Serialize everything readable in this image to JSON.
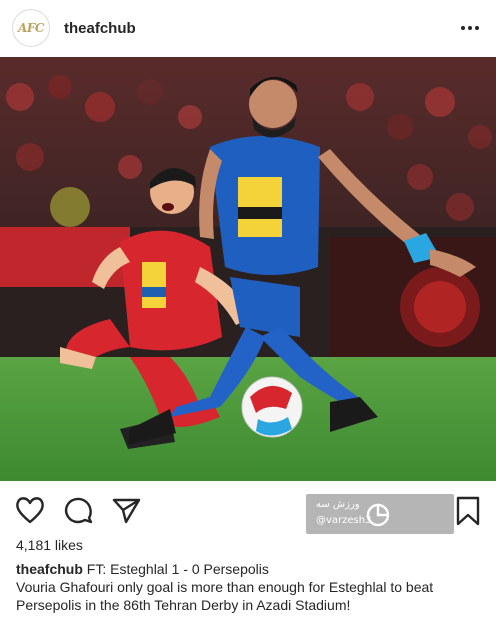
{
  "header": {
    "avatar_text": "AFC",
    "username": "theafchub",
    "more_icon": "more-horizontal-icon"
  },
  "post": {
    "image_alt": "Football players from Persepolis and Esteghlal contesting the ball",
    "watermark": {
      "arabic": "ورزش سه",
      "handle": "@varzesh3"
    }
  },
  "actions": {
    "like_icon": "heart-icon",
    "comment_icon": "comment-icon",
    "share_icon": "send-icon",
    "save_icon": "bookmark-icon"
  },
  "likes_text": "4,181 likes",
  "caption": {
    "username": "theafchub",
    "line1": "FT: Esteghlal 1 - 0 Persepolis",
    "body": "Vouria Ghafouri only goal is more than enough for Esteghlal to beat Persepolis in the 86th Tehran Derby in Azadi Stadium!"
  },
  "colors": {
    "text": "#262626",
    "persepolis_red": "#d8262e",
    "esteghlal_blue": "#1f5fc0",
    "grass": "#4f9a3c"
  }
}
